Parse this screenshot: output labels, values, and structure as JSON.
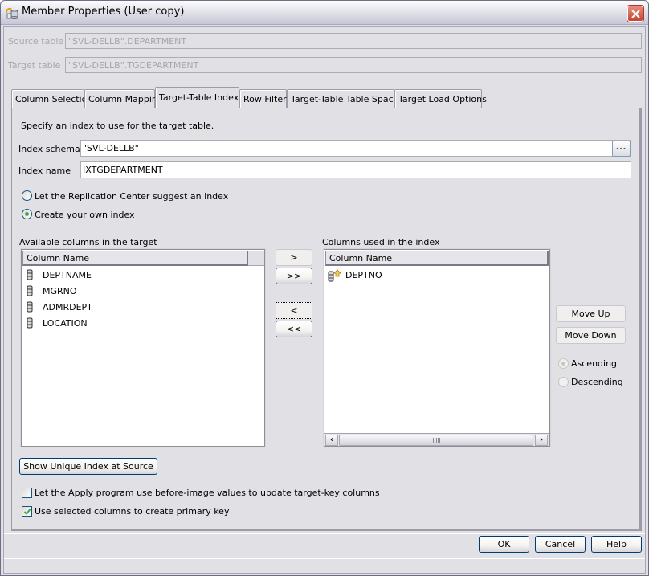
{
  "window": {
    "title": "Member Properties (User copy)"
  },
  "header": {
    "source_table_label": "Source table",
    "source_table_value": "\"SVL-DELLB\".DEPARTMENT",
    "target_table_label": "Target table",
    "target_table_value": "\"SVL-DELLB\".TGDEPARTMENT"
  },
  "tabs": [
    {
      "label": "Column Selection",
      "active": false
    },
    {
      "label": "Column Mapping",
      "active": false
    },
    {
      "label": "Target-Table Index",
      "active": true
    },
    {
      "label": "Row Filter",
      "active": false
    },
    {
      "label": "Target-Table Table Space",
      "active": false
    },
    {
      "label": "Target Load Options",
      "active": false
    }
  ],
  "panel": {
    "description": "Specify an index to use for the target table.",
    "index_schema_label": "Index schema",
    "index_schema_value": "\"SVL-DELLB\"",
    "browse_label": "...",
    "index_name_label": "Index name",
    "index_name_value": "IXTGDEPARTMENT",
    "radio_suggest": {
      "label": "Let the Replication Center suggest an index",
      "checked": false
    },
    "radio_create": {
      "label": "Create your own index",
      "checked": true
    },
    "available": {
      "label": "Available columns in the target",
      "header": "Column Name",
      "items": [
        "DEPTNAME",
        "MGRNO",
        "ADMRDEPT",
        "LOCATION"
      ]
    },
    "used": {
      "label": "Columns used in the index",
      "header": "Column Name",
      "items": [
        {
          "name": "DEPTNO",
          "order": "ascending"
        }
      ]
    },
    "move_buttons": {
      "add": ">",
      "add_all": ">>",
      "remove": "<",
      "remove_all": "<<"
    },
    "move_up_label": "Move Up",
    "move_down_label": "Move Down",
    "ascending": {
      "label": "Ascending",
      "checked": true,
      "enabled": false
    },
    "descending": {
      "label": "Descending",
      "checked": false,
      "enabled": false
    },
    "show_unique_label": "Show Unique Index at Source",
    "check_before_image": {
      "label": "Let the Apply program use before-image values to update target-key columns",
      "checked": false
    },
    "check_primary_key": {
      "label": "Use selected columns to create primary key",
      "checked": true
    }
  },
  "footer": {
    "ok_label": "OK",
    "cancel_label": "Cancel",
    "help_label": "Help"
  },
  "colors": {
    "window_bg": "#e1e0e5",
    "button_border": "#003c74",
    "checkmark": "#3fa93f",
    "close_button": "#c64532"
  }
}
